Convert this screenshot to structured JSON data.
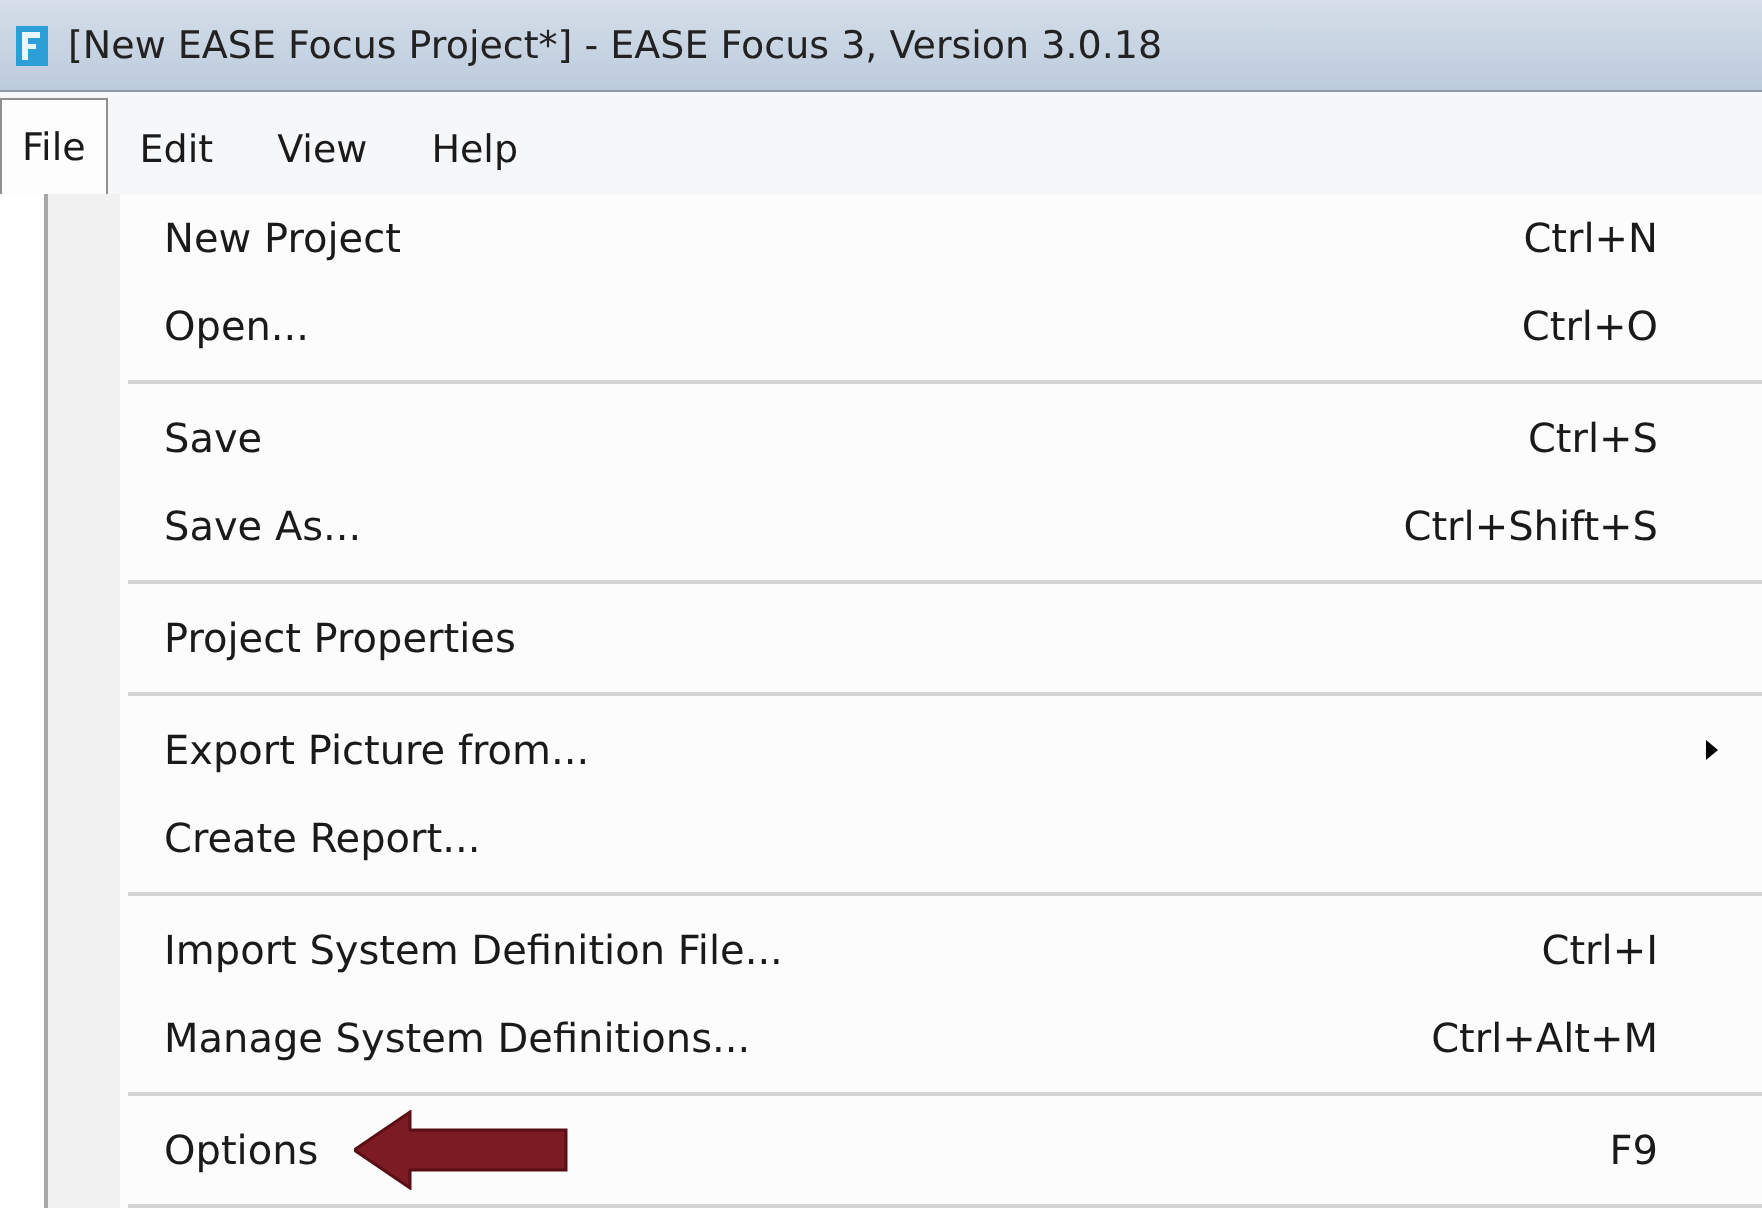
{
  "window": {
    "title": "[New EASE Focus Project*] - EASE Focus 3, Version 3.0.18"
  },
  "menu_bar": [
    {
      "label": "File",
      "selected": true
    },
    {
      "label": "Edit",
      "selected": false
    },
    {
      "label": "View",
      "selected": false
    },
    {
      "label": "Help",
      "selected": false
    }
  ],
  "file_menu": {
    "groups": [
      [
        {
          "label": "New Project",
          "shortcut": "Ctrl+N",
          "submenu": false,
          "pointed": false
        },
        {
          "label": "Open...",
          "shortcut": "Ctrl+O",
          "submenu": false,
          "pointed": false
        }
      ],
      [
        {
          "label": "Save",
          "shortcut": "Ctrl+S",
          "submenu": false,
          "pointed": false
        },
        {
          "label": "Save As...",
          "shortcut": "Ctrl+Shift+S",
          "submenu": false,
          "pointed": false
        }
      ],
      [
        {
          "label": "Project Properties",
          "submenu": false,
          "pointed": false
        }
      ],
      [
        {
          "label": "Export Picture from...",
          "submenu": true,
          "pointed": false
        },
        {
          "label": "Create Report...",
          "submenu": false,
          "pointed": false
        }
      ],
      [
        {
          "label": "Import System Definition File...",
          "shortcut": "Ctrl+I",
          "submenu": false,
          "pointed": false
        },
        {
          "label": "Manage System Definitions...",
          "shortcut": "Ctrl+Alt+M",
          "submenu": false,
          "pointed": false
        }
      ],
      [
        {
          "label": "Options",
          "shortcut": "F9",
          "submenu": false,
          "pointed": true
        }
      ]
    ]
  }
}
